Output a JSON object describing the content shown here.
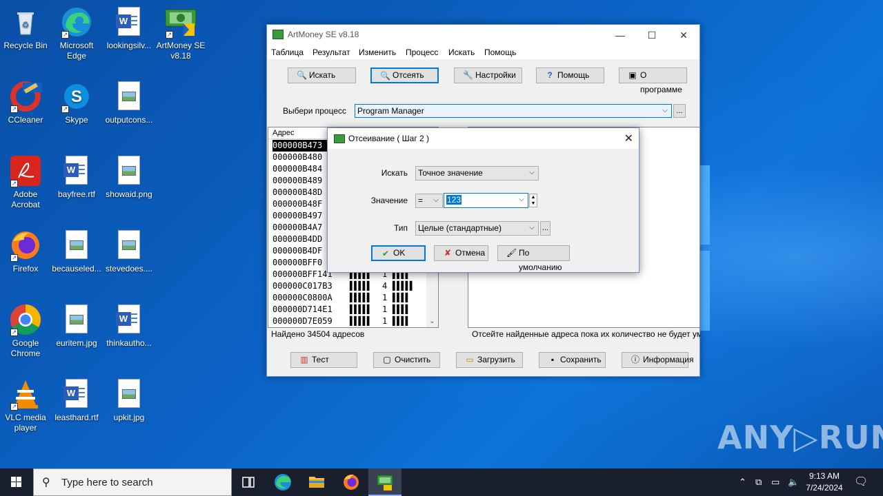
{
  "desktop": {
    "icons": [
      {
        "label": "Recycle Bin"
      },
      {
        "label": "Microsoft Edge"
      },
      {
        "label": "lookingsilv..."
      },
      {
        "label": "ArtMoney SE v8.18"
      },
      {
        "label": "CCleaner"
      },
      {
        "label": "Skype"
      },
      {
        "label": "outputcons..."
      },
      {
        "label": "Adobe Acrobat"
      },
      {
        "label": "bayfree.rtf"
      },
      {
        "label": "showaid.png"
      },
      {
        "label": "Firefox"
      },
      {
        "label": "becauseled..."
      },
      {
        "label": "stevedoes...."
      },
      {
        "label": "Google Chrome"
      },
      {
        "label": "euritem.jpg"
      },
      {
        "label": "thinkautho..."
      },
      {
        "label": "VLC media player"
      },
      {
        "label": "leasthard.rtf"
      },
      {
        "label": "upkit.jpg"
      }
    ],
    "watermark": "ANY▷RUN"
  },
  "artmoney": {
    "title": "ArtMoney SE v8.18",
    "menu": [
      "Таблица",
      "Результат",
      "Изменить",
      "Процесс",
      "Искать",
      "Помощь"
    ],
    "toolbar": {
      "search": "Искать",
      "filter": "Отсеять",
      "settings": "Настройки",
      "help": "Помощь",
      "about": "О программе"
    },
    "process_label": "Выбери процесс",
    "process_value": "Program Manager",
    "process_more": "...",
    "list_header": "Адрес",
    "rows": [
      {
        "addr": "000000B473",
        "v1": "",
        "v2": "",
        "v3": ""
      },
      {
        "addr": "000000B480",
        "v1": "",
        "v2": "",
        "v3": ""
      },
      {
        "addr": "000000B484",
        "v1": "",
        "v2": "",
        "v3": ""
      },
      {
        "addr": "000000B489",
        "v1": "",
        "v2": "",
        "v3": ""
      },
      {
        "addr": "000000B48D",
        "v1": "",
        "v2": "",
        "v3": ""
      },
      {
        "addr": "000000B48F",
        "v1": "",
        "v2": "",
        "v3": ""
      },
      {
        "addr": "000000B497",
        "v1": "",
        "v2": "",
        "v3": ""
      },
      {
        "addr": "000000B4A7",
        "v1": "",
        "v2": "",
        "v3": ""
      },
      {
        "addr": "000000B4DD",
        "v1": "",
        "v2": "",
        "v3": ""
      },
      {
        "addr": "000000B4DF",
        "v1": "",
        "v2": "",
        "v3": ""
      },
      {
        "addr": "000000BFF0",
        "v1": "",
        "v2": "",
        "v3": ""
      },
      {
        "addr": "000000BFF141",
        "v1": "▌▌▌▌▌",
        "v2": "1",
        "v3": "▌▌▌▌"
      },
      {
        "addr": "000000C017B3",
        "v1": "▌▌▌▌▌",
        "v2": "4",
        "v3": "▌▌▌▌▌"
      },
      {
        "addr": "000000C0800A",
        "v1": "▌▌▌▌▌",
        "v2": "1",
        "v3": "▌▌▌▌"
      },
      {
        "addr": "000000D714E1",
        "v1": "▌▌▌▌▌",
        "v2": "1",
        "v3": "▌▌▌▌"
      },
      {
        "addr": "000000D7E059",
        "v1": "▌▌▌▌▌",
        "v2": "1",
        "v3": "▌▌▌▌"
      }
    ],
    "found_status": "Найдено 34504 адресов",
    "hint_status": "Отсейте найденные адреса пока их количество не будет уме",
    "bottom": {
      "test": "Тест",
      "clear": "Очистить",
      "load": "Загрузить",
      "save": "Сохранить",
      "info": "Информация"
    }
  },
  "dialog": {
    "title": "Отсеивание ( Шаг 2 )",
    "search_label": "Искать",
    "search_value": "Точное значение",
    "value_label": "Значение",
    "operator": "=",
    "value": "123",
    "type_label": "Тип",
    "type_value": "Целые (стандартные)",
    "type_more": "...",
    "ok": "OK",
    "cancel": "Отмена",
    "default": "По умолчанию"
  },
  "taskbar": {
    "search_placeholder": "Type here to search",
    "time": "9:13 AM",
    "date": "7/24/2024"
  }
}
